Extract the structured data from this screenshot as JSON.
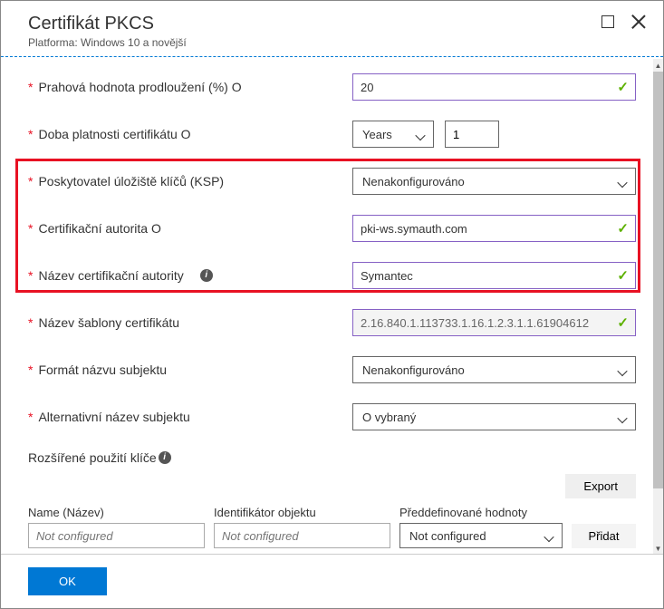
{
  "header": {
    "title": "Certifikát PKCS",
    "subtitle": "Platforma: Windows 10 a novější"
  },
  "fields": {
    "threshold": {
      "label": "Prahová hodnota prodloužení (%) O",
      "value": "20"
    },
    "validity": {
      "label": "Doba platnosti certifikátu O",
      "unit": "Years",
      "value": "1"
    },
    "ksp": {
      "label": "Poskytovatel úložiště klíčů (KSP)",
      "value": "Nenakonfigurováno"
    },
    "ca": {
      "label": "Certifikační autorita O",
      "value": "pki-ws.symauth.com"
    },
    "caName": {
      "label": "Název certifikační autority",
      "value": "Symantec"
    },
    "template": {
      "label": "Název šablony certifikátu",
      "value": "2.16.840.1.113733.1.16.1.2.3.1.1.61904612"
    },
    "subjectFormat": {
      "label": "Formát názvu subjektu",
      "value": "Nenakonfigurováno"
    },
    "altName": {
      "label": "Alternativní název subjektu",
      "value": "O vybraný"
    },
    "eku": {
      "label": "Rozšířené použití klíče"
    }
  },
  "table": {
    "exportLabel": "Export",
    "headers": {
      "name": "Name (Název)",
      "oid": "Identifikátor objektu",
      "predef": "Předdefinované hodnoty"
    },
    "row": {
      "namePlaceholder": "Not configured",
      "oidPlaceholder": "Not configured",
      "predefValue": "Not configured"
    },
    "addLabel": "Přidat"
  },
  "footer": {
    "ok": "OK"
  }
}
